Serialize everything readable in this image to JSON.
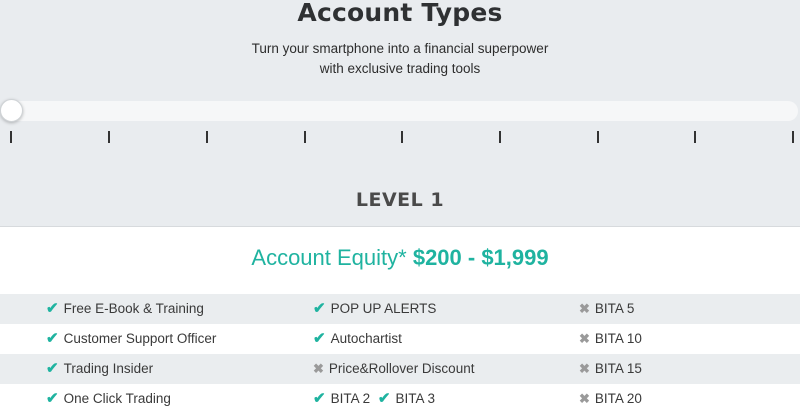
{
  "page": {
    "title": "Account Types",
    "subtitle_line1": "Turn your smartphone into a financial superpower",
    "subtitle_line2": "with exclusive trading tools"
  },
  "slider": {
    "selected_level_index": 0,
    "tick_count": 9
  },
  "level": {
    "label": "LEVEL 1"
  },
  "equity": {
    "label": "Account Equity*",
    "range": "$200 - $1,999"
  },
  "features": {
    "rows": [
      {
        "c1": "Free E-Book & Training",
        "c2": "POP UP ALERTS",
        "c3": "BITA 5"
      },
      {
        "c1": "Customer Support Officer",
        "c2": "Autochartist",
        "c3": "BITA 10"
      },
      {
        "c1": "Trading Insider",
        "c2": "Price&Rollover Discount",
        "c3": "BITA 15"
      },
      {
        "c1": "One Click Trading",
        "c2a": "BITA 2",
        "c2b": "BITA 3",
        "c3": "BITA 20"
      }
    ]
  },
  "icons": {
    "included": "check-icon",
    "excluded": "cross-icon"
  },
  "colors": {
    "accent": "#1fb3a0",
    "background": "#e9ecef",
    "excluded": "#9a9a9a"
  }
}
